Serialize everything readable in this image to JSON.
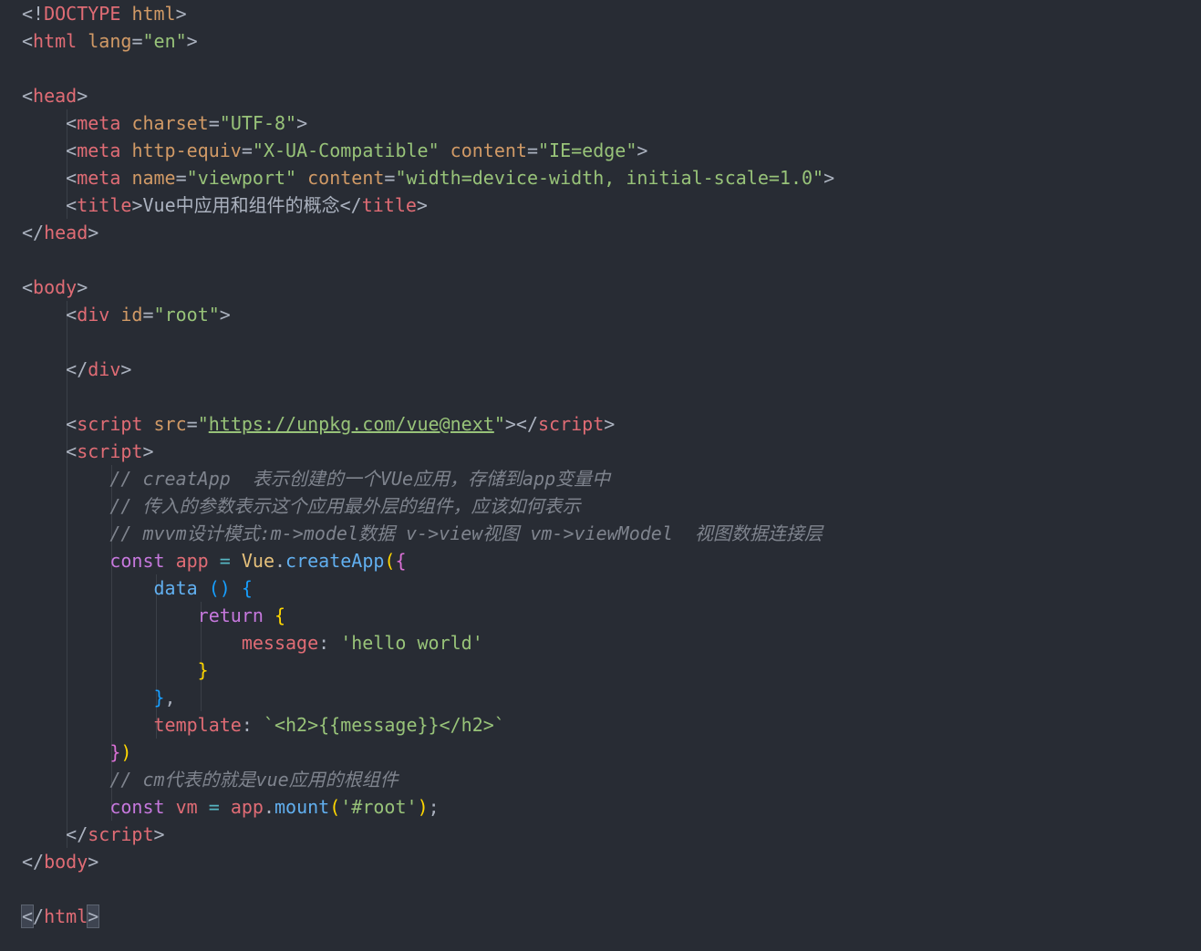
{
  "editor": {
    "language": "html",
    "colors": {
      "background": "#282c34",
      "current_line": "#2c313c",
      "indent_guide": "#3b4048",
      "tag": "#e06c75",
      "attribute": "#d19a66",
      "string": "#98c379",
      "keyword": "#c678dd",
      "function": "#61afef",
      "property": "#56b6c2",
      "comment": "#7f848e",
      "bracket_level_1": "#ffd700",
      "bracket_level_2": "#da70d6",
      "bracket_level_3": "#179fff"
    },
    "lines": [
      [
        {
          "t": "<!",
          "c": "punct"
        },
        {
          "t": "DOCTYPE",
          "c": "red"
        },
        {
          "t": " ",
          "c": "plain"
        },
        {
          "t": "html",
          "c": "orange"
        },
        {
          "t": ">",
          "c": "punct"
        }
      ],
      [
        {
          "t": "<",
          "c": "punct"
        },
        {
          "t": "html",
          "c": "red"
        },
        {
          "t": " ",
          "c": "plain"
        },
        {
          "t": "lang",
          "c": "orange"
        },
        {
          "t": "=",
          "c": "punct"
        },
        {
          "t": "\"en\"",
          "c": "green"
        },
        {
          "t": ">",
          "c": "punct"
        }
      ],
      [],
      [
        {
          "t": "<",
          "c": "punct"
        },
        {
          "t": "head",
          "c": "red"
        },
        {
          "t": ">",
          "c": "punct"
        }
      ],
      [
        {
          "t": "    ",
          "c": "plain"
        },
        {
          "t": "<",
          "c": "punct"
        },
        {
          "t": "meta",
          "c": "red"
        },
        {
          "t": " ",
          "c": "plain"
        },
        {
          "t": "charset",
          "c": "orange"
        },
        {
          "t": "=",
          "c": "punct"
        },
        {
          "t": "\"UTF-8\"",
          "c": "green"
        },
        {
          "t": ">",
          "c": "punct"
        }
      ],
      [
        {
          "t": "    ",
          "c": "plain"
        },
        {
          "t": "<",
          "c": "punct"
        },
        {
          "t": "meta",
          "c": "red"
        },
        {
          "t": " ",
          "c": "plain"
        },
        {
          "t": "http-equiv",
          "c": "orange"
        },
        {
          "t": "=",
          "c": "punct"
        },
        {
          "t": "\"X-UA-Compatible\"",
          "c": "green"
        },
        {
          "t": " ",
          "c": "plain"
        },
        {
          "t": "content",
          "c": "orange"
        },
        {
          "t": "=",
          "c": "punct"
        },
        {
          "t": "\"IE=edge\"",
          "c": "green"
        },
        {
          "t": ">",
          "c": "punct"
        }
      ],
      [
        {
          "t": "    ",
          "c": "plain"
        },
        {
          "t": "<",
          "c": "punct"
        },
        {
          "t": "meta",
          "c": "red"
        },
        {
          "t": " ",
          "c": "plain"
        },
        {
          "t": "name",
          "c": "orange"
        },
        {
          "t": "=",
          "c": "punct"
        },
        {
          "t": "\"viewport\"",
          "c": "green"
        },
        {
          "t": " ",
          "c": "plain"
        },
        {
          "t": "content",
          "c": "orange"
        },
        {
          "t": "=",
          "c": "punct"
        },
        {
          "t": "\"width=device-width, initial-scale=1.0\"",
          "c": "green"
        },
        {
          "t": ">",
          "c": "punct"
        }
      ],
      [
        {
          "t": "    ",
          "c": "plain"
        },
        {
          "t": "<",
          "c": "punct"
        },
        {
          "t": "title",
          "c": "red"
        },
        {
          "t": ">",
          "c": "punct"
        },
        {
          "t": "Vue中应用和组件的概念",
          "c": "plain"
        },
        {
          "t": "</",
          "c": "punct"
        },
        {
          "t": "title",
          "c": "red"
        },
        {
          "t": ">",
          "c": "punct"
        }
      ],
      [
        {
          "t": "</",
          "c": "punct"
        },
        {
          "t": "head",
          "c": "red"
        },
        {
          "t": ">",
          "c": "punct"
        }
      ],
      [],
      [
        {
          "t": "<",
          "c": "punct"
        },
        {
          "t": "body",
          "c": "red"
        },
        {
          "t": ">",
          "c": "punct"
        }
      ],
      [
        {
          "t": "    ",
          "c": "plain"
        },
        {
          "t": "<",
          "c": "punct"
        },
        {
          "t": "div",
          "c": "red"
        },
        {
          "t": " ",
          "c": "plain"
        },
        {
          "t": "id",
          "c": "orange"
        },
        {
          "t": "=",
          "c": "punct"
        },
        {
          "t": "\"root\"",
          "c": "green"
        },
        {
          "t": ">",
          "c": "punct"
        }
      ],
      [],
      [
        {
          "t": "    ",
          "c": "plain"
        },
        {
          "t": "</",
          "c": "punct"
        },
        {
          "t": "div",
          "c": "red"
        },
        {
          "t": ">",
          "c": "punct"
        }
      ],
      [],
      [
        {
          "t": "    ",
          "c": "plain"
        },
        {
          "t": "<",
          "c": "punct"
        },
        {
          "t": "script",
          "c": "red"
        },
        {
          "t": " ",
          "c": "plain"
        },
        {
          "t": "src",
          "c": "orange"
        },
        {
          "t": "=",
          "c": "punct"
        },
        {
          "t": "\"",
          "c": "green"
        },
        {
          "t": "https://unpkg.com/vue@next",
          "c": "green",
          "link": true
        },
        {
          "t": "\"",
          "c": "green"
        },
        {
          "t": "></",
          "c": "punct"
        },
        {
          "t": "script",
          "c": "red"
        },
        {
          "t": ">",
          "c": "punct"
        }
      ],
      [
        {
          "t": "    ",
          "c": "plain"
        },
        {
          "t": "<",
          "c": "punct"
        },
        {
          "t": "script",
          "c": "red"
        },
        {
          "t": ">",
          "c": "punct"
        }
      ],
      [
        {
          "t": "        ",
          "c": "plain"
        },
        {
          "t": "// creatApp  表示创建的一个VUe应用，存储到app变量中",
          "c": "comment"
        }
      ],
      [
        {
          "t": "        ",
          "c": "plain"
        },
        {
          "t": "// 传入的参数表示这个应用最外层的组件，应该如何表示",
          "c": "comment"
        }
      ],
      [
        {
          "t": "        ",
          "c": "plain"
        },
        {
          "t": "// mvvm设计模式:m->model数据 v->view视图 vm->viewModel  视图数据连接层",
          "c": "comment"
        }
      ],
      [
        {
          "t": "        ",
          "c": "plain"
        },
        {
          "t": "const",
          "c": "purple"
        },
        {
          "t": " ",
          "c": "plain"
        },
        {
          "t": "app",
          "c": "red"
        },
        {
          "t": " ",
          "c": "plain"
        },
        {
          "t": "=",
          "c": "cyan"
        },
        {
          "t": " ",
          "c": "plain"
        },
        {
          "t": "Vue",
          "c": "yellow"
        },
        {
          "t": ".",
          "c": "punct"
        },
        {
          "t": "createApp",
          "c": "blue"
        },
        {
          "t": "(",
          "c": "gold"
        },
        {
          "t": "{",
          "c": "magenta"
        }
      ],
      [
        {
          "t": "            ",
          "c": "plain"
        },
        {
          "t": "data",
          "c": "blue"
        },
        {
          "t": " ",
          "c": "plain"
        },
        {
          "t": "()",
          "c": "sky"
        },
        {
          "t": " ",
          "c": "plain"
        },
        {
          "t": "{",
          "c": "sky"
        }
      ],
      [
        {
          "t": "                ",
          "c": "plain"
        },
        {
          "t": "return",
          "c": "purple"
        },
        {
          "t": " ",
          "c": "plain"
        },
        {
          "t": "{",
          "c": "gold"
        }
      ],
      [
        {
          "t": "                    ",
          "c": "plain"
        },
        {
          "t": "message",
          "c": "red"
        },
        {
          "t": ": ",
          "c": "punct"
        },
        {
          "t": "'hello world'",
          "c": "green"
        }
      ],
      [
        {
          "t": "                ",
          "c": "plain"
        },
        {
          "t": "}",
          "c": "gold"
        }
      ],
      [
        {
          "t": "            ",
          "c": "plain"
        },
        {
          "t": "}",
          "c": "sky"
        },
        {
          "t": ",",
          "c": "punct"
        }
      ],
      [
        {
          "t": "            ",
          "c": "plain"
        },
        {
          "t": "template",
          "c": "red"
        },
        {
          "t": ": ",
          "c": "punct"
        },
        {
          "t": "`<h2>{{message}}</h2>`",
          "c": "green"
        }
      ],
      [
        {
          "t": "        ",
          "c": "plain"
        },
        {
          "t": "}",
          "c": "magenta"
        },
        {
          "t": ")",
          "c": "gold"
        }
      ],
      [
        {
          "t": "        ",
          "c": "plain"
        },
        {
          "t": "// cm代表的就是vue应用的根组件",
          "c": "comment"
        }
      ],
      [
        {
          "t": "        ",
          "c": "plain"
        },
        {
          "t": "const",
          "c": "purple"
        },
        {
          "t": " ",
          "c": "plain"
        },
        {
          "t": "vm",
          "c": "red"
        },
        {
          "t": " ",
          "c": "plain"
        },
        {
          "t": "=",
          "c": "cyan"
        },
        {
          "t": " ",
          "c": "plain"
        },
        {
          "t": "app",
          "c": "red"
        },
        {
          "t": ".",
          "c": "punct"
        },
        {
          "t": "mount",
          "c": "blue"
        },
        {
          "t": "(",
          "c": "gold"
        },
        {
          "t": "'#root'",
          "c": "green"
        },
        {
          "t": ")",
          "c": "gold"
        },
        {
          "t": ";",
          "c": "punct"
        }
      ],
      [
        {
          "t": "    ",
          "c": "plain"
        },
        {
          "t": "</",
          "c": "punct"
        },
        {
          "t": "script",
          "c": "red"
        },
        {
          "t": ">",
          "c": "punct"
        }
      ],
      [
        {
          "t": "</",
          "c": "punct"
        },
        {
          "t": "body",
          "c": "red"
        },
        {
          "t": ">",
          "c": "punct"
        }
      ],
      [],
      [
        {
          "t": "<",
          "c": "punct",
          "match": true
        },
        {
          "t": "/",
          "c": "punct"
        },
        {
          "t": "html",
          "c": "red"
        },
        {
          "t": ">",
          "c": "punct",
          "match": true
        }
      ]
    ],
    "current_line_index": 34
  }
}
